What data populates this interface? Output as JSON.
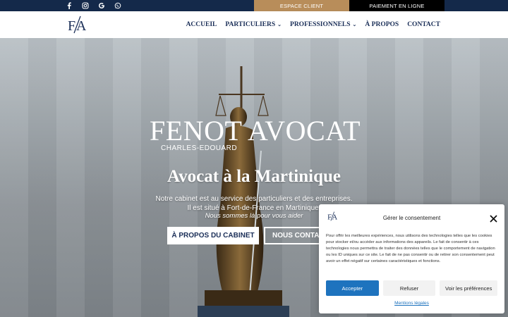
{
  "topbar": {
    "social_icons": [
      "facebook-icon",
      "instagram-icon",
      "google-icon",
      "whatsapp-icon"
    ],
    "espace_client_label": "ESPACE CLIENT",
    "paiement_label": "PAIEMENT EN LIGNE",
    "colors": {
      "bar": "#14294a",
      "espace": "#b88d5a",
      "paiement": "#000000"
    }
  },
  "header": {
    "logo_text": "FA",
    "nav": {
      "accueil": "ACCUEIL",
      "particuliers": "PARTICULIERS",
      "professionnels": "PROFESSIONNELS",
      "a_propos": "À PROPOS",
      "contact": "CONTACT"
    },
    "nav_color": "#1b2f58"
  },
  "hero": {
    "title": "FENOT AVOCAT",
    "subname": "CHARLES-EDOUARD",
    "heading": "Avocat à la Martinique",
    "line1": "Notre cabinet est au service des particuliers et des entreprises.",
    "line2": "Il est situé à Fort-de-France en Martinique.",
    "line3": "Nous sommes là pour vous aider",
    "cta_about": "À PROPOS DU CABINET",
    "cta_contact": "NOUS CONTACTER"
  },
  "consent": {
    "title": "Gérer le consentement",
    "text": "Pour offrir les meilleures expériences, nous utilisons des technologies telles que les cookies pour stocker et/ou accéder aux informations des appareils. Le fait de consentir à ces technologies nous permettra de traiter des données telles que le comportement de navigation ou les ID uniques sur ce site. Le fait de ne pas consentir ou de retirer son consentement peut avoir un effet négatif sur certaines caractéristiques et fonctions.",
    "accept": "Accepter",
    "refuse": "Refuser",
    "preferences": "Voir les préférences",
    "legal": "Mentions légales",
    "accent": "#1e73be"
  }
}
